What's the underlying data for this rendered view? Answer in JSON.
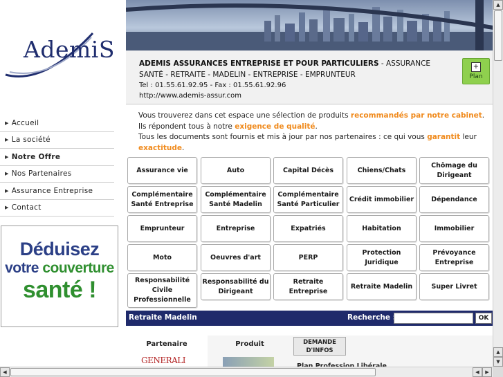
{
  "logo": {
    "text": "AdemiS"
  },
  "nav": {
    "items": [
      {
        "label": "Accueil",
        "active": false
      },
      {
        "label": "La société",
        "active": false
      },
      {
        "label": "Notre Offre",
        "active": true
      },
      {
        "label": "Nos Partenaires",
        "active": false
      },
      {
        "label": "Assurance Entreprise",
        "active": false
      },
      {
        "label": "Contact",
        "active": false
      }
    ]
  },
  "promo": {
    "line1": "Déduisez",
    "line2a": "votre",
    "line2b": "couverture",
    "line3": "santé !"
  },
  "header": {
    "company_bold": "ADEMIS ASSURANCES ENTREPRISE ET POUR PARTICULIERS",
    "company_rest": " - ASSURANCE SANTÉ - RETRAITE - MADELIN - ENTREPRISE - EMPRUNTEUR",
    "tel": "Tel : 01.55.61.92.95 - Fax : 01.55.61.92.96",
    "url": "http://www.ademis-assur.com",
    "plan_icon": "+",
    "plan_label": "Plan"
  },
  "intro": {
    "p1a": "Vous trouverez dans cet espace une sélection de produits ",
    "p1b": "recommandés par notre cabinet",
    "p1c": ". Ils répondent tous à notre ",
    "p1d": "exigence de qualité",
    "p1e": ".",
    "p2a": "Tous les documents sont fournis et mis à jour par nos partenaires : ce qui vous ",
    "p2b": "garantit",
    "p2c": " leur ",
    "p2d": "exactitude",
    "p2e": "."
  },
  "products": [
    "Assurance vie",
    "Auto",
    "Capital Décès",
    "Chiens/Chats",
    "Chômage du Dirigeant",
    "Complémentaire Santé Entreprise",
    "Complémentaire Santé Madelin",
    "Complémentaire Santé Particulier",
    "Crédit immobilier",
    "Dépendance",
    "Emprunteur",
    "Entreprise",
    "Expatriés",
    "Habitation",
    "Immobilier",
    "Moto",
    "Oeuvres d'art",
    "PERP",
    "Protection Juridique",
    "Prévoyance Entreprise",
    "Responsabilité Civile Professionnelle",
    "Responsabilité du Dirigeant",
    "Retraite Entreprise",
    "Retraite Madelin",
    "Super Livret"
  ],
  "search": {
    "section_title": "Retraite Madelin",
    "label": "Recherche :",
    "value": "",
    "ok_label": "OK"
  },
  "tabs": {
    "partenaire": "Partenaire",
    "produit": "Produit",
    "demande": "DEMANDE D'INFOS",
    "partner_logo": "GENERALI",
    "product_title": "Plan Profession Libérale"
  },
  "colors": {
    "navy": "#1f2a6b",
    "accent_orange": "#f08a1c",
    "plan_green": "#8fd04e",
    "promo_blue": "#2b3f86",
    "promo_green": "#2f8f2f"
  }
}
